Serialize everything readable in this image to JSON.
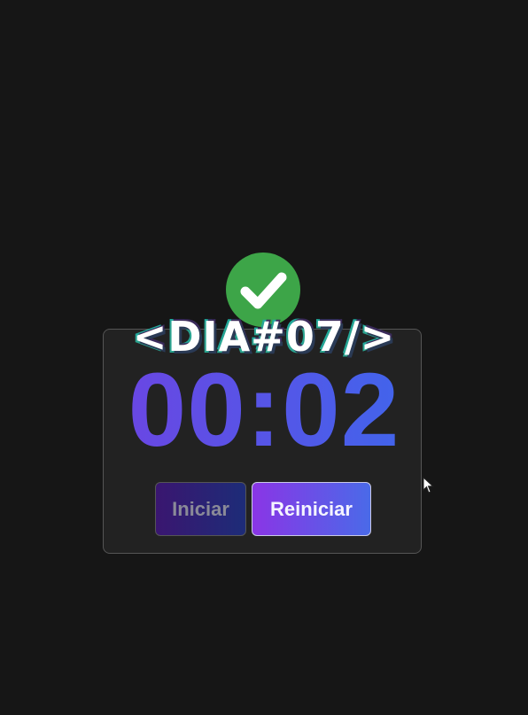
{
  "header": {
    "title": "<DIA#07/>",
    "badge_icon": "checkmark-circle-icon"
  },
  "timer": {
    "display": "00:02",
    "gradient_start": "#7b3ae0",
    "gradient_end": "#2f72ef"
  },
  "controls": {
    "start_label": "Iniciar",
    "reset_label": "Reiniciar"
  },
  "colors": {
    "background": "#161616",
    "card": "#222222",
    "badge_green": "#3da548"
  }
}
